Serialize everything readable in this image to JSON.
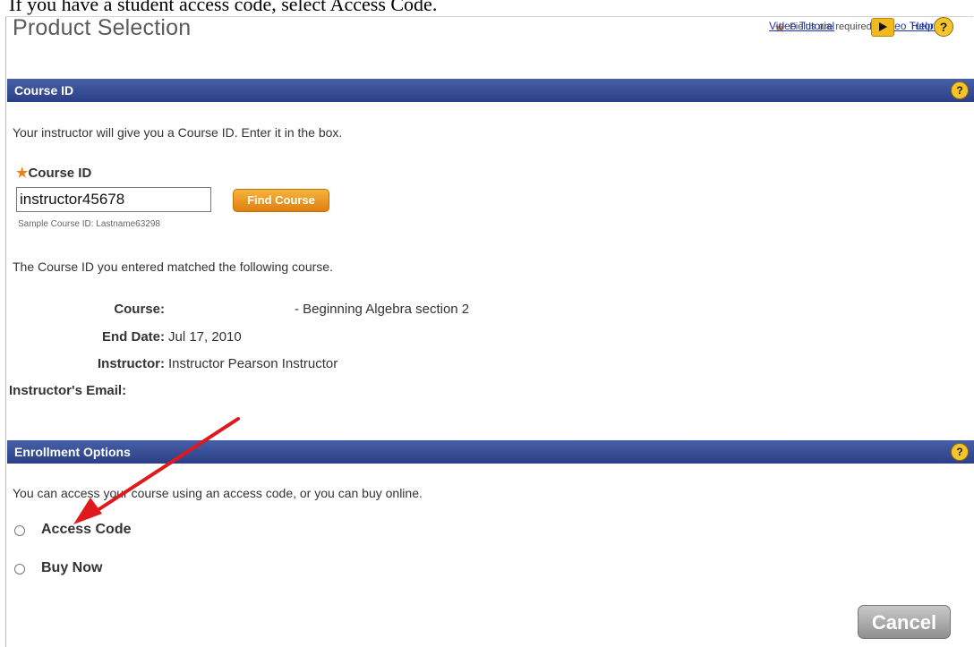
{
  "caption": "If you have a student access code, select Access Code.",
  "header": {
    "title": "Product Selection",
    "required_note": "Fields are required",
    "video_tutorial": "Video Tutorial",
    "help": "Help"
  },
  "course_section": {
    "title": "Course ID",
    "instructions": "Your instructor will give you a Course ID. Enter it in the box.",
    "field_label": "Course ID",
    "field_value": "instructor45678",
    "find_button": "Find Course",
    "sample": "Sample Course ID: Lastname63298",
    "match_text": "The Course ID you entered matched the following course.",
    "details": [
      {
        "label": "Course:",
        "value": "- Beginning Algebra section 2"
      },
      {
        "label": "End Date:",
        "value": "Jul 17, 2010"
      },
      {
        "label": "Instructor:",
        "value": "Instructor Pearson Instructor"
      },
      {
        "label": "Instructor's Email:",
        "value": ""
      }
    ]
  },
  "enrollment_section": {
    "title": "Enrollment Options",
    "instructions": "You can access your course using an access code, or you can buy online.",
    "options": [
      "Access Code",
      "Buy Now"
    ]
  },
  "buttons": {
    "cancel": "Cancel"
  },
  "icons": {
    "required": "required-star-icon",
    "video": "play-icon",
    "help": "help-icon",
    "annotation": "red-arrow-icon"
  },
  "colors": {
    "section_bar": "#2c3f86",
    "accent_orange": "#df7f0f",
    "arrow_red": "#e0191d"
  }
}
